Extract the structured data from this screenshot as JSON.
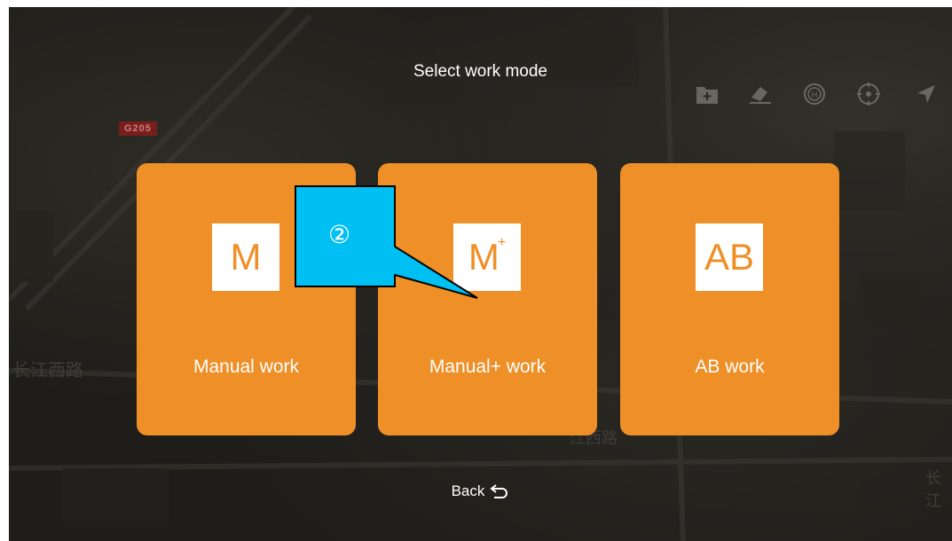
{
  "screen": {
    "title": "Select work mode",
    "modes": [
      {
        "label": "Manual work",
        "badge": "M",
        "superscript": ""
      },
      {
        "label": "Manual+ work",
        "badge": "M",
        "superscript": "+"
      },
      {
        "label": "AB work",
        "badge": "AB",
        "superscript": ""
      }
    ],
    "back_label": "Back",
    "accent_color": "#ef8f27",
    "callout_color": "#00bff3",
    "callout_text": "②"
  },
  "map": {
    "road_badge": "G205",
    "street_labels": [
      "长江西路",
      "江西路",
      "长江"
    ]
  },
  "toolbar": {
    "icons": [
      "add-folder-icon",
      "eraser-icon",
      "helipad-icon",
      "compass-icon",
      "locate-arrow-icon"
    ]
  }
}
